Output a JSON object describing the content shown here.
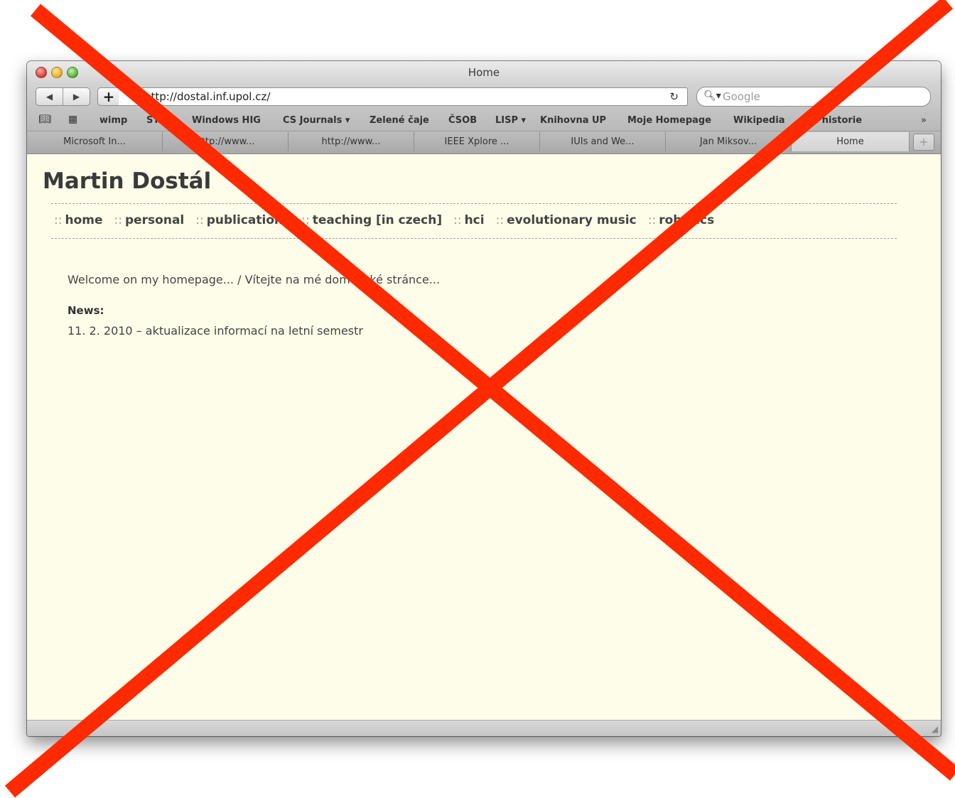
{
  "window": {
    "title": "Home"
  },
  "toolbar": {
    "back_icon": "back-arrow-icon",
    "forward_icon": "forward-arrow-icon",
    "add_label": "+",
    "url": "http://dostal.inf.upol.cz/",
    "reload_icon": "reload-icon",
    "search_placeholder": "Google"
  },
  "bookmarks": {
    "items": [
      "wimp",
      "STAG",
      "Windows HIG",
      "CS Journals ▾",
      "Zelené čaje",
      "ČSOB",
      "LISP ▾",
      "Knihovna UP",
      "Moje Homepage",
      "Wikipedia",
      "CHI historie"
    ],
    "overflow": "»"
  },
  "tabs": [
    {
      "label": "Microsoft In..."
    },
    {
      "label": "http://www..."
    },
    {
      "label": "http://www..."
    },
    {
      "label": "IEEE Xplore ..."
    },
    {
      "label": "IUIs and We..."
    },
    {
      "label": "Jan Miksov..."
    },
    {
      "label": "Home"
    }
  ],
  "page": {
    "title": "Martin Dostál",
    "nav_separator": "::",
    "nav": [
      "home",
      "personal",
      "publications",
      "teaching [in czech]",
      "hci",
      "evolutionary music",
      "robotics"
    ],
    "welcome": "Welcome on my homepage... / Vítejte na mé domovské stránce...",
    "news_label": "News:",
    "news_item": "11. 2. 2010 – aktualizace informací na letní semestr"
  },
  "overlay": {
    "color": "#ff2a00"
  }
}
